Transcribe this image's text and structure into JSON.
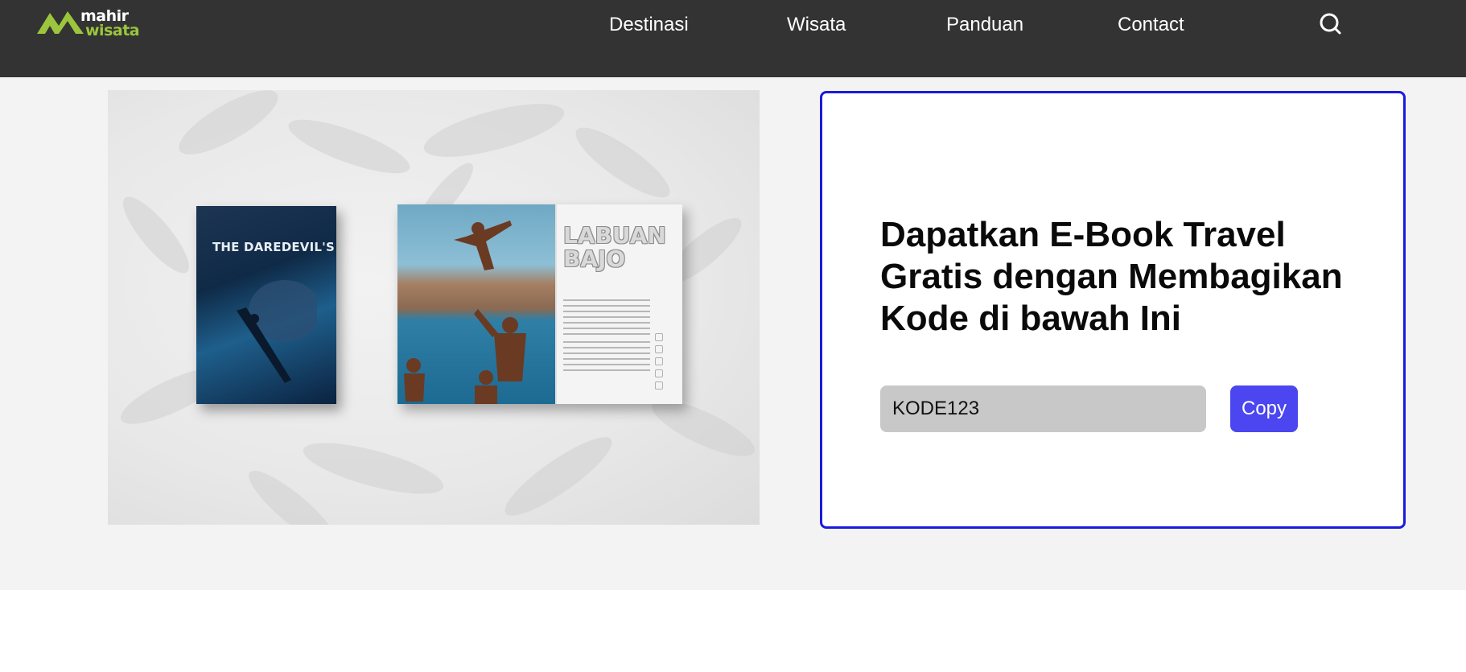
{
  "brand": {
    "line1": "mahir",
    "line2": "wisata",
    "accent": "#9bc53d"
  },
  "nav": {
    "items": [
      {
        "label": "Destinasi"
      },
      {
        "label": "Wisata"
      },
      {
        "label": "Panduan"
      },
      {
        "label": "Contact"
      }
    ],
    "search_icon": "search-icon"
  },
  "promo": {
    "book_left_title": "THE DAREDEVIL'S",
    "book_right_title": "LABUAN\nBAJO",
    "heading": "Dapatkan E-Book Travel Gratis dengan Membagikan Kode di bawah Ini",
    "code_value": "KODE123",
    "copy_label": "Copy",
    "colors": {
      "card_border": "#1a1adf",
      "button": "#4b46f0",
      "header": "#333333"
    }
  }
}
